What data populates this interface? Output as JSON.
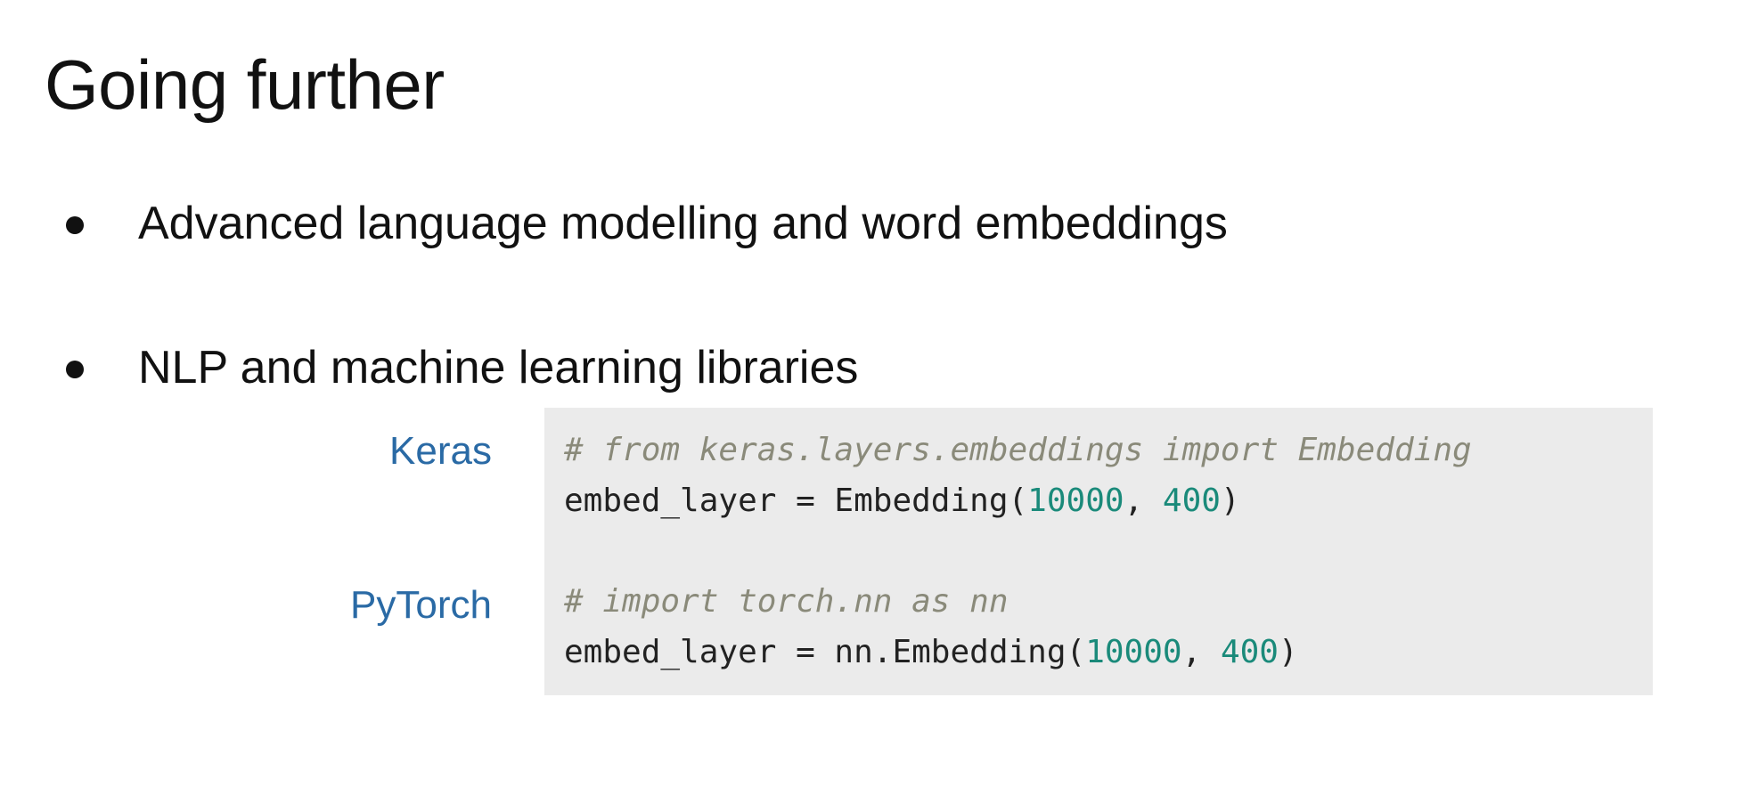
{
  "slide": {
    "title": "Going further",
    "bullets": [
      "Advanced language modelling and word embeddings",
      "NLP and machine learning libraries"
    ]
  },
  "libraries": [
    {
      "label": "Keras",
      "comment": "# from keras.layers.embeddings import Embedding",
      "code_prefix": "embed_layer = Embedding(",
      "arg1": "10000",
      "sep": ", ",
      "arg2": "400",
      "code_suffix": ")"
    },
    {
      "label": "PyTorch",
      "comment": "# import torch.nn as nn",
      "code_prefix": "embed_layer = nn.Embedding(",
      "arg1": "10000",
      "sep": ", ",
      "arg2": "400",
      "code_suffix": ")"
    }
  ],
  "colors": {
    "label": "#2a6aa5",
    "comment": "#8a8a7a",
    "number": "#1a8a7a",
    "code_background": "#ebebeb"
  }
}
